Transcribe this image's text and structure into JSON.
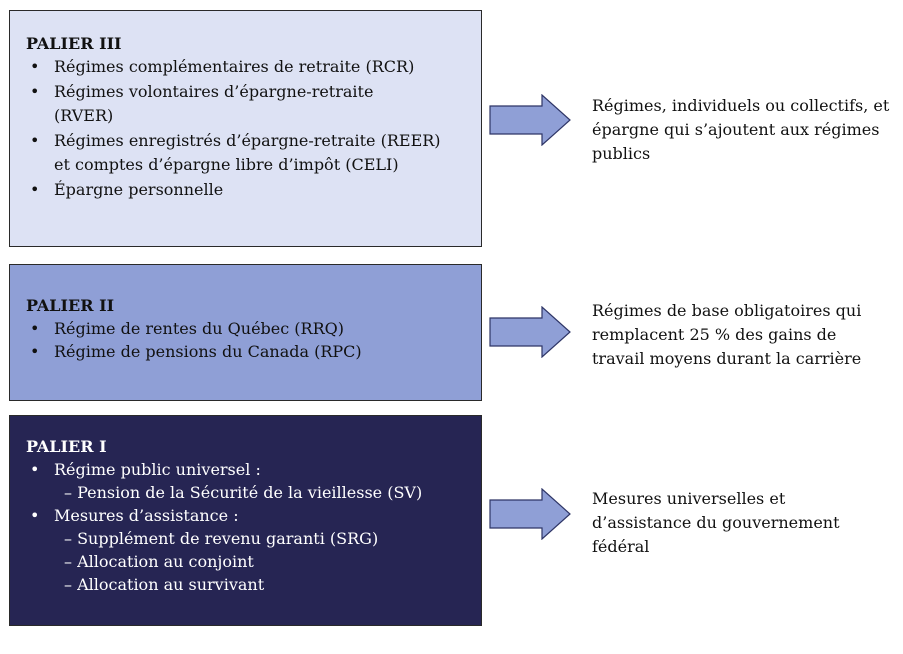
{
  "tiers": {
    "tier3": {
      "title": "PALIER III",
      "items": [
        "Régimes complémentaires de retraite (RCR)",
        "Régimes volontaires d’épargne-retraite (RVER)",
        "Régimes enregistrés d’épargne-retraite (REER) et comptes d’épargne libre d’impôt (CELI)",
        "Épargne personnelle"
      ],
      "description": "Régimes, individuels ou collectifs, et épargne qui s’ajoutent aux régimes publics"
    },
    "tier2": {
      "title": "PALIER II",
      "items": [
        "Régime de rentes du Québec (RRQ)",
        "Régime de pensions du Canada (RPC)"
      ],
      "description": "Régimes de base obligatoires qui remplacent 25 % des gains de travail moyens durant la carrière"
    },
    "tier1": {
      "title": "PALIER I",
      "item1": "Régime public universel :",
      "item1_sub": [
        "– Pension de la Sécurité de la vieillesse (SV)"
      ],
      "item2": "Mesures d’assistance :",
      "item2_sub": [
        "– Supplément de revenu garanti (SRG)",
        "– Allocation au conjoint",
        "– Allocation au survivant"
      ],
      "description": "Mesures universelles et d’assistance du gouvernement fédéral"
    }
  },
  "colors": {
    "tier3_fill": "#dde2f4",
    "tier2_fill": "#8f9fd6",
    "tier1_fill": "#262553",
    "arrow_fill": "#8f9fd6"
  },
  "icons": {
    "arrow": "right-arrow-icon"
  }
}
